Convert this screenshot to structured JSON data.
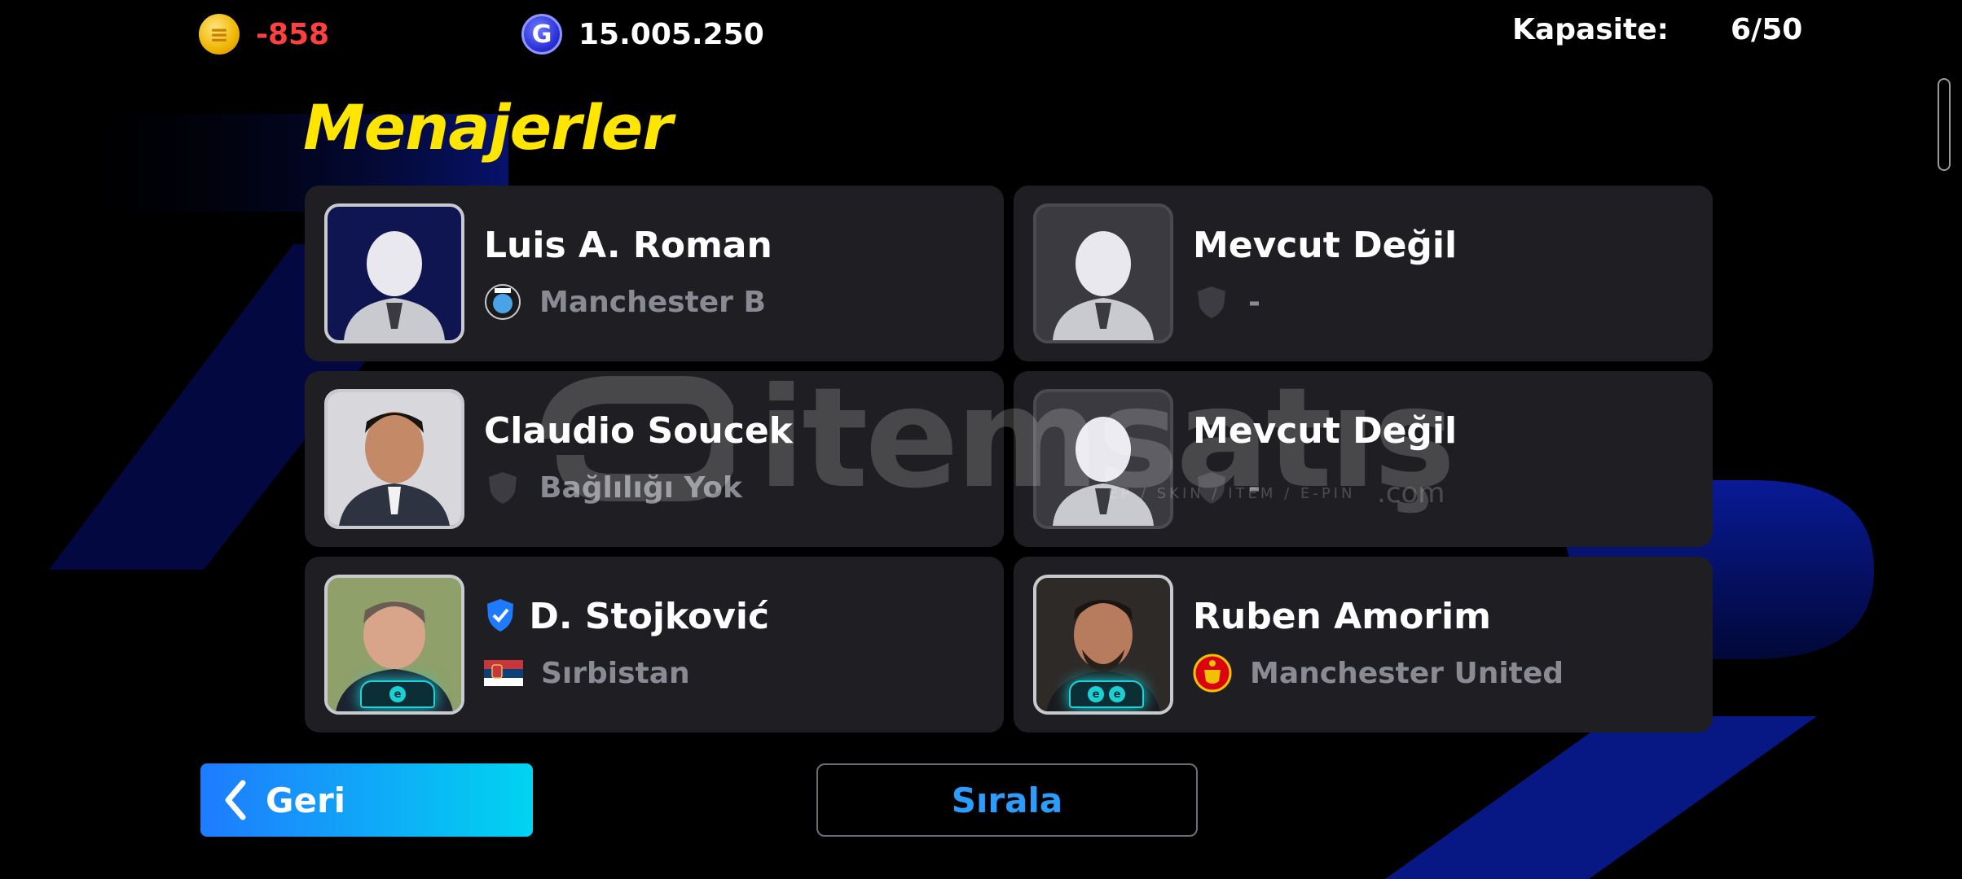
{
  "topbar": {
    "coin_value": "-858",
    "gp_value": "15.005.250",
    "gp_icon_letter": "G",
    "capacity_label": "Kapasite:",
    "capacity_value": "6/50"
  },
  "page_title": "Menajerler",
  "managers": [
    {
      "name": "Luis A. Roman",
      "team": "Manchester B",
      "avatar": "placeholder",
      "team_icon": "club-crest-icon"
    },
    {
      "name": "Mevcut Değil",
      "team": "-",
      "avatar": "placeholder-empty",
      "team_icon": "shield-icon"
    },
    {
      "name": "Claudio Soucek",
      "team": "Bağlılığı Yok",
      "avatar": "photo",
      "team_icon": "shield-icon"
    },
    {
      "name": "Mevcut Değil",
      "team": "-",
      "avatar": "placeholder-empty",
      "team_icon": "shield-icon"
    },
    {
      "name": "D. Stojković",
      "team": "Sırbistan",
      "avatar": "photo",
      "team_icon": "serbia-flag-icon",
      "verified": true
    },
    {
      "name": "Ruben Amorim",
      "team": "Manchester United",
      "avatar": "photo",
      "team_icon": "manchester-united-crest-icon"
    }
  ],
  "buttons": {
    "back_label": "Geri",
    "sort_label": "Sırala"
  },
  "watermark": {
    "brand": "itemsatış",
    "tagline": "EP / SKIN / ITEM / E-PIN",
    "tld": ".com"
  },
  "colors": {
    "title": "#ffe600",
    "coin_negative": "#ff4040",
    "accent_blue": "#2b9dff",
    "card_bg": "#1f1f23"
  }
}
